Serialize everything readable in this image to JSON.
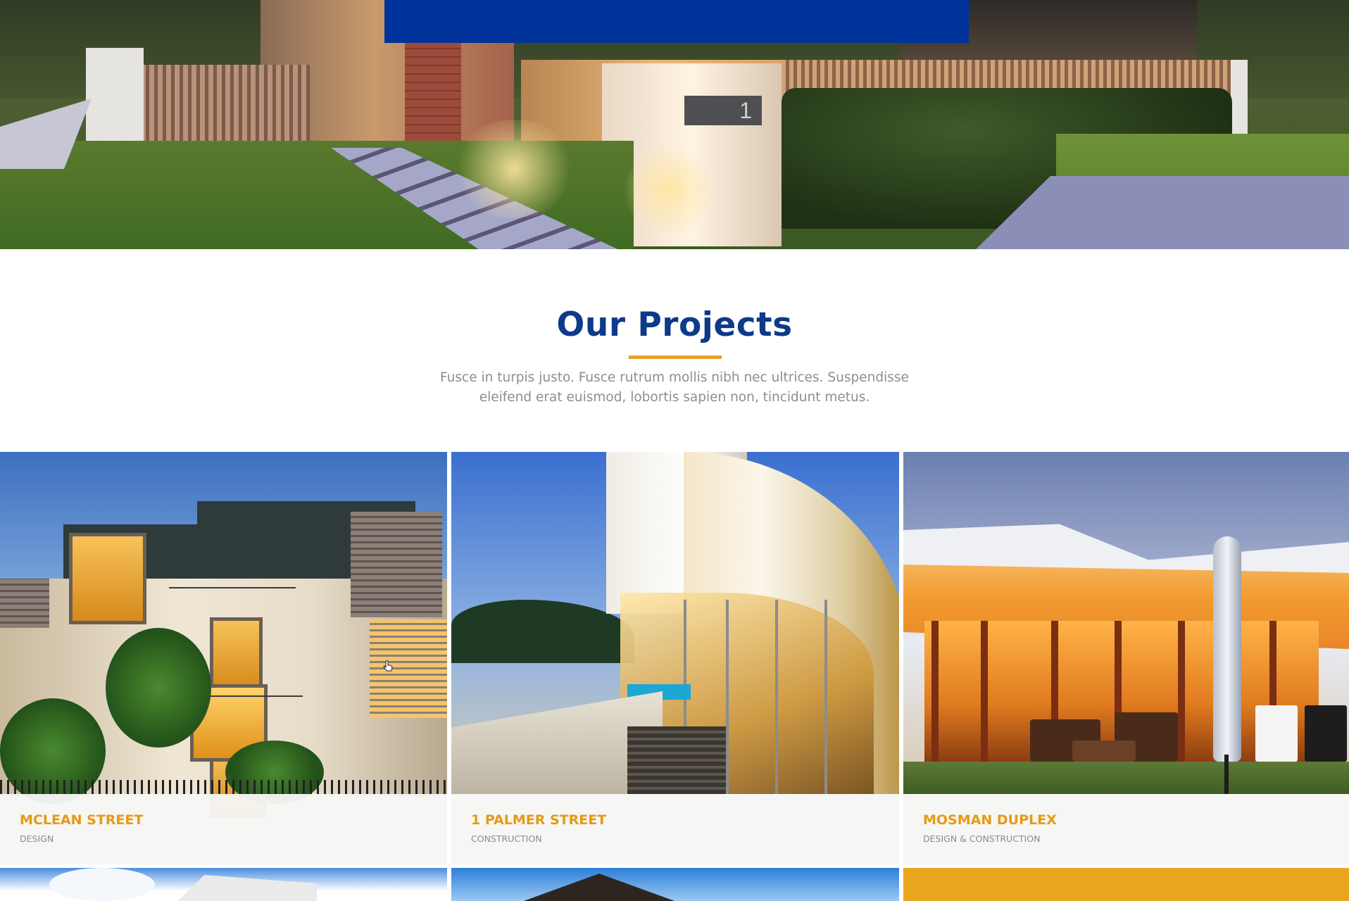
{
  "section": {
    "title": "Our Projects",
    "description": "Fusce in turpis justo. Fusce rutrum mollis nibh nec ultrices. Suspendisse eleifend erat euismod, lobortis sapien non, tincidunt metus."
  },
  "hero": {
    "mailbox_number": "1"
  },
  "projects": [
    {
      "title": "MCLEAN STREET",
      "category": "DESIGN"
    },
    {
      "title": "1 PALMER STREET",
      "category": "CONSTRUCTION"
    },
    {
      "title": "MOSMAN DUPLEX",
      "category": "DESIGN & CONSTRUCTION"
    }
  ],
  "colors": {
    "brand_blue": "#003399",
    "title_blue": "#0d3a8a",
    "accent_orange": "#e8a12a",
    "caption_orange": "#e59a16",
    "muted_text": "#8e8e8e"
  },
  "icons": {
    "cursor": "hand-pointer-icon"
  }
}
